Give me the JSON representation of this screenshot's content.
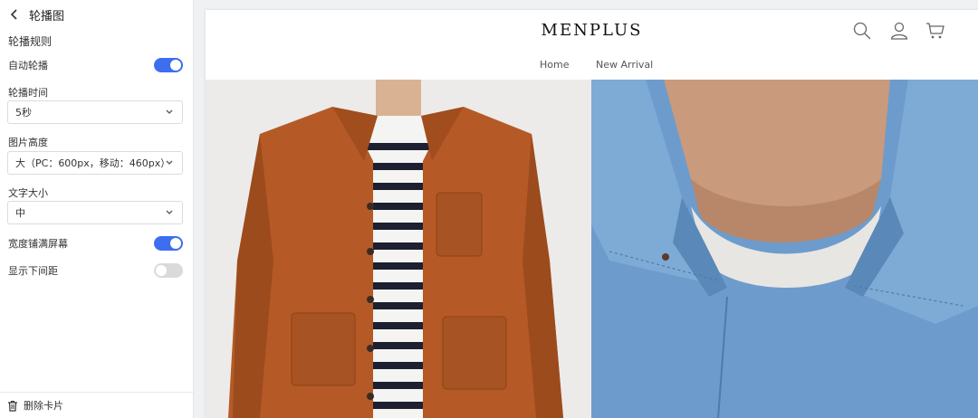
{
  "panel": {
    "title": "轮播图",
    "section_title": "轮播规则",
    "autoplay": {
      "label": "自动轮播",
      "on": true
    },
    "interval": {
      "label": "轮播时间",
      "value": "5秒"
    },
    "height": {
      "label": "图片高度",
      "value": "大（PC：600px，移动：460px）"
    },
    "font_size": {
      "label": "文字大小",
      "value": "中"
    },
    "full_width": {
      "label": "宽度铺满屏幕",
      "on": true
    },
    "bottom_spacing": {
      "label": "显示下间距",
      "on": false
    },
    "delete_label": "删除卡片"
  },
  "preview": {
    "logo": "MENPLUS",
    "nav": [
      "Home",
      "New Arrival"
    ],
    "icons": [
      "search-icon",
      "account-icon",
      "cart-icon"
    ]
  },
  "colors": {
    "accent": "#3d6ef0",
    "toggle_off": "#d9dadc"
  }
}
